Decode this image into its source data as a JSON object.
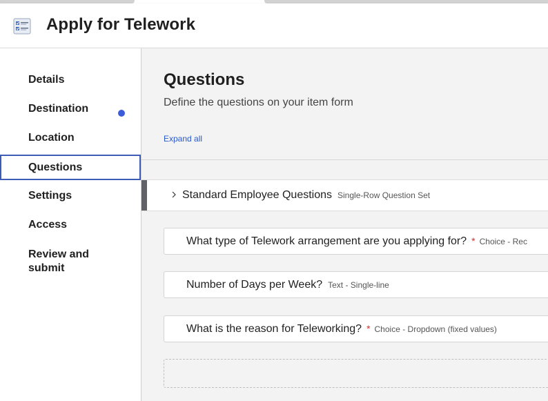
{
  "header": {
    "title": "Apply for Telework",
    "icon": "form-checklist-icon"
  },
  "sidebar": {
    "items": [
      {
        "label": "Details"
      },
      {
        "label": "Destination",
        "indicator": "blue-dot"
      },
      {
        "label": "Location"
      },
      {
        "label": "Questions",
        "active": true
      },
      {
        "label": "Settings"
      },
      {
        "label": "Access"
      },
      {
        "label": "Review and submit"
      }
    ],
    "dot_color": "#3b5bdb",
    "active_border_color": "#3b5bb5"
  },
  "main": {
    "heading": "Questions",
    "subheading": "Define the questions on your item form",
    "expand_all": "Expand all",
    "section": {
      "label": "Standard Employee Questions",
      "type": "Single-Row Question Set",
      "icon": "chevron-right-icon"
    },
    "questions": [
      {
        "text": "What type of Telework arrangement are you applying for?",
        "required_mark": "*",
        "type": "Choice - Rec"
      },
      {
        "text": "Number of Days per Week?",
        "required_mark": "",
        "type": "Text - Single-line"
      },
      {
        "text": "What is the reason for Teleworking?",
        "required_mark": "*",
        "type": "Choice - Dropdown (fixed values)"
      }
    ]
  },
  "colors": {
    "link": "#2a58c9",
    "required": "#d0312d",
    "section_accent": "#5f6368",
    "main_background": "#f3f3f3"
  }
}
